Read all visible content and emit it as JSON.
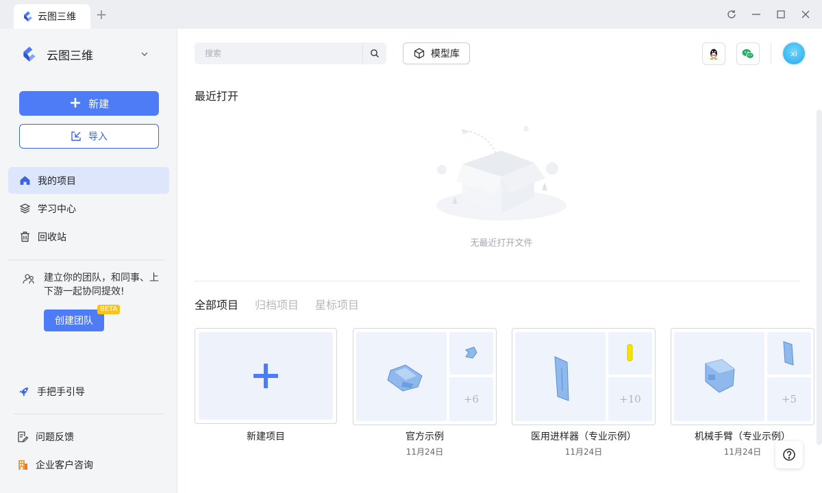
{
  "window": {
    "tab_title": "云图三维",
    "new_tab_icon": "plus-icon",
    "controls": [
      "refresh-icon",
      "minimize-icon",
      "maximize-icon",
      "close-icon"
    ]
  },
  "sidebar": {
    "brand": "云图三维",
    "new_label": "新建",
    "import_label": "导入",
    "nav": [
      {
        "label": "我的项目",
        "icon": "home-icon",
        "active": true
      },
      {
        "label": "学习中心",
        "icon": "layers-icon",
        "active": false
      },
      {
        "label": "回收站",
        "icon": "trash-icon",
        "active": false
      }
    ],
    "team_text": "建立你的团队，和同事、上下游一起协同提效!",
    "team_button": "创建团队",
    "beta": "BETA",
    "guide": "手把手引导",
    "feedback": "问题反馈",
    "enterprise": "企业客户咨询"
  },
  "toolbar": {
    "search_placeholder": "搜索",
    "model_library": "模型库",
    "avatar_initials": "xi"
  },
  "recent": {
    "title": "最近打开",
    "empty_text": "无最近打开文件"
  },
  "projects": {
    "tabs": [
      {
        "label": "全部项目",
        "active": true
      },
      {
        "label": "归档项目",
        "active": false
      },
      {
        "label": "星标项目",
        "active": false
      }
    ],
    "new_project": "新建项目",
    "items": [
      {
        "name": "官方示例",
        "date": "11月24日",
        "more": "+6"
      },
      {
        "name": "医用进样器（专业示例）",
        "date": "11月24日",
        "more": "+10"
      },
      {
        "name": "机械手臂（专业示例）",
        "date": "11月24日",
        "more": "+5"
      }
    ]
  },
  "colors": {
    "primary": "#4d7cf6",
    "sidebar_bg": "#f4f5f7",
    "active_nav_bg": "#dde6fb",
    "beta": "#f8c21f"
  }
}
